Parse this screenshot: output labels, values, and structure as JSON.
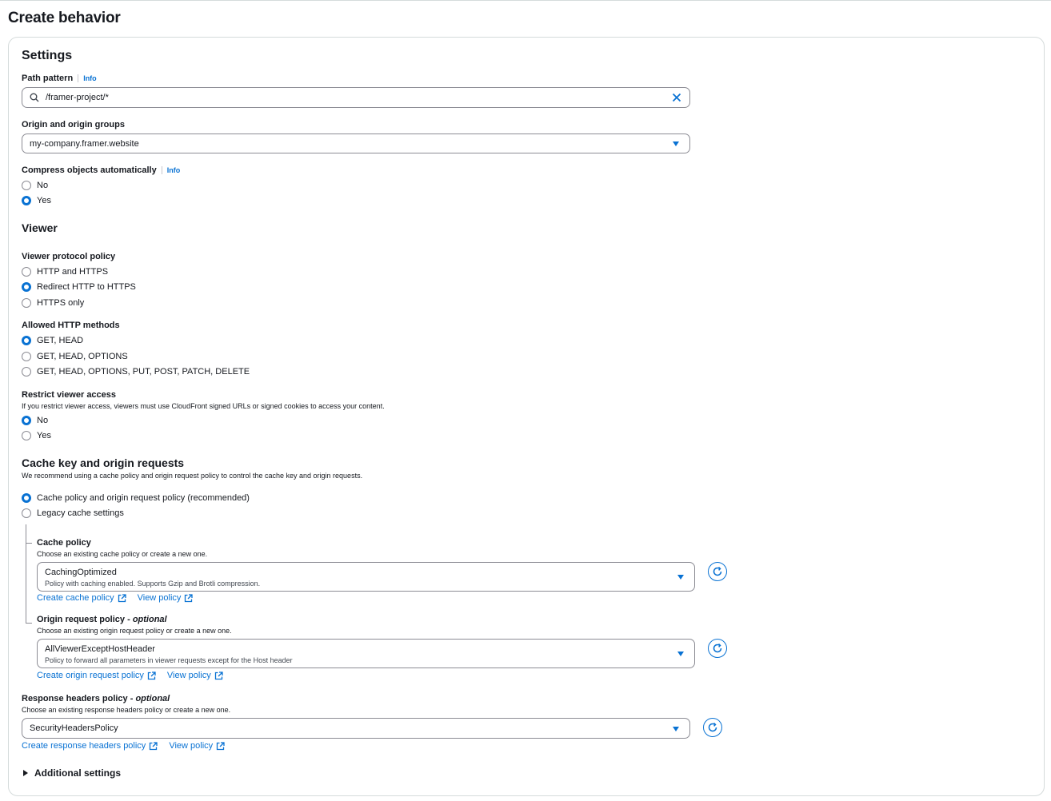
{
  "page": {
    "title": "Create behavior"
  },
  "settings": {
    "heading": "Settings",
    "path_pattern": {
      "label": "Path pattern",
      "info": "Info",
      "value": "/framer-project/*"
    },
    "origin": {
      "label": "Origin and origin groups",
      "value": "my-company.framer.website"
    },
    "compress": {
      "label": "Compress objects automatically",
      "info": "Info",
      "options": [
        "No",
        "Yes"
      ],
      "selected": "Yes"
    }
  },
  "viewer": {
    "heading": "Viewer",
    "protocol": {
      "label": "Viewer protocol policy",
      "options": [
        "HTTP and HTTPS",
        "Redirect HTTP to HTTPS",
        "HTTPS only"
      ],
      "selected": "Redirect HTTP to HTTPS"
    },
    "methods": {
      "label": "Allowed HTTP methods",
      "options": [
        "GET, HEAD",
        "GET, HEAD, OPTIONS",
        "GET, HEAD, OPTIONS, PUT, POST, PATCH, DELETE"
      ],
      "selected": "GET, HEAD"
    },
    "restrict": {
      "label": "Restrict viewer access",
      "description": "If you restrict viewer access, viewers must use CloudFront signed URLs or signed cookies to access your content.",
      "options": [
        "No",
        "Yes"
      ],
      "selected": "No"
    }
  },
  "cache": {
    "heading": "Cache key and origin requests",
    "description": "We recommend using a cache policy and origin request policy to control the cache key and origin requests.",
    "options": [
      "Cache policy and origin request policy (recommended)",
      "Legacy cache settings"
    ],
    "selected": "Cache policy and origin request policy (recommended)",
    "cache_policy": {
      "label": "Cache policy",
      "description": "Choose an existing cache policy or create a new one.",
      "value": "CachingOptimized",
      "value_description": "Policy with caching enabled. Supports Gzip and Brotli compression.",
      "create_link": "Create cache policy",
      "view_link": "View policy"
    },
    "origin_request_policy": {
      "label": "Origin request policy",
      "optional": "optional",
      "description": "Choose an existing origin request policy or create a new one.",
      "value": "AllViewerExceptHostHeader",
      "value_description": "Policy to forward all parameters in viewer requests except for the Host header",
      "create_link": "Create origin request policy",
      "view_link": "View policy"
    },
    "response_headers_policy": {
      "label": "Response headers policy",
      "optional": "optional",
      "description": "Choose an existing response headers policy or create a new one.",
      "value": "SecurityHeadersPolicy",
      "create_link": "Create response headers policy",
      "view_link": "View policy"
    }
  },
  "additional": {
    "label": "Additional settings"
  },
  "colors": {
    "accent": "#0972d3",
    "text": "#16191f",
    "border": "#8c8c94"
  }
}
